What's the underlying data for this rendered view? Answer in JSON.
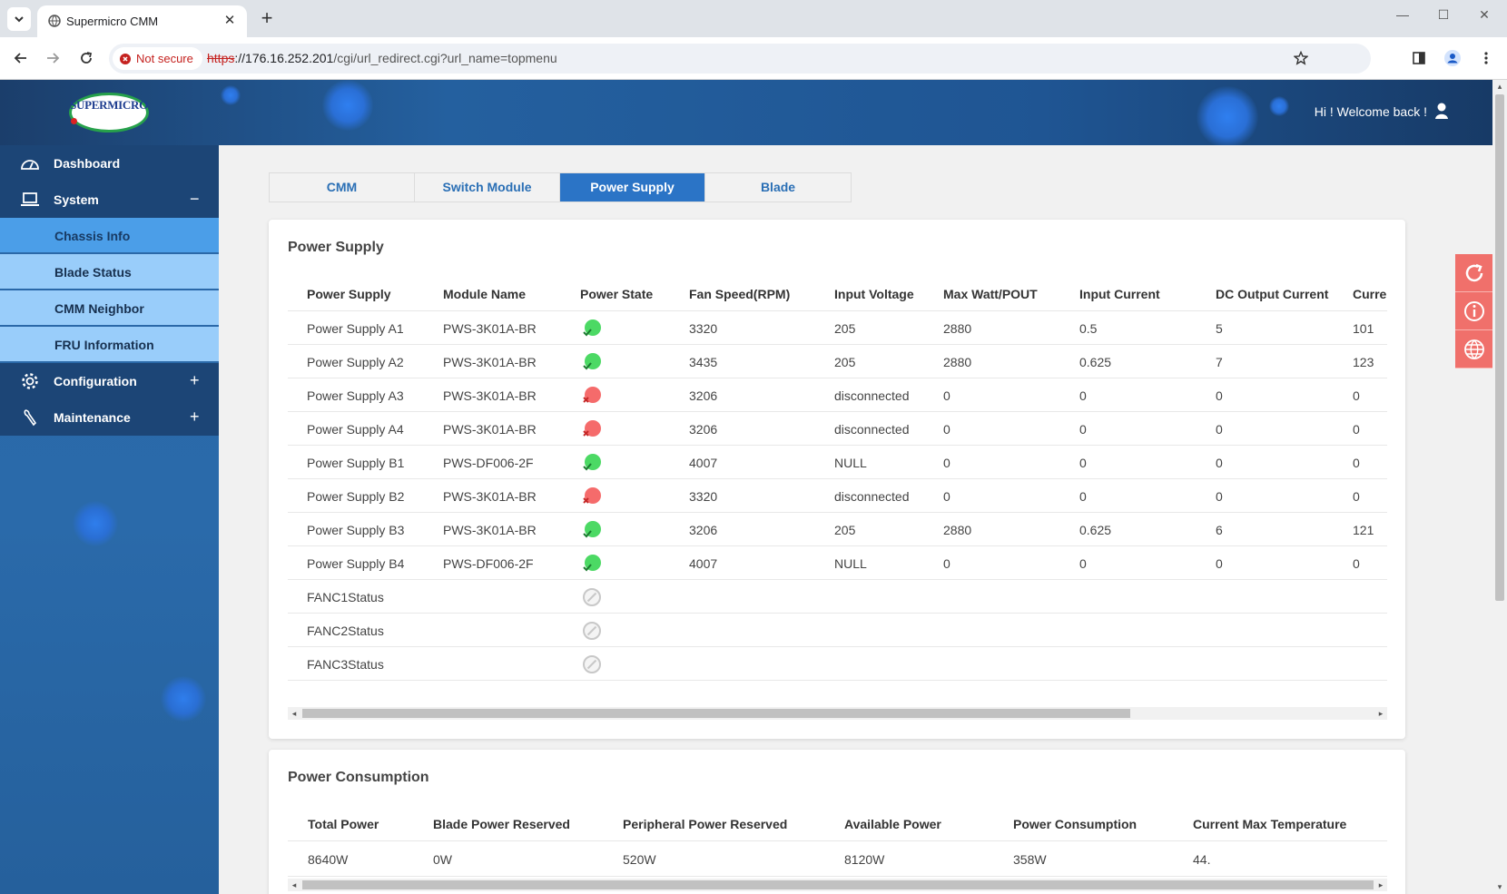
{
  "browser": {
    "tab_title": "Supermicro CMM",
    "tab_close": "✕",
    "new_tab": "+",
    "security_label": "Not secure",
    "url_scheme": "https",
    "url_host": "://176.16.252.201",
    "url_path": "/cgi/url_redirect.cgi?url_name=topmenu"
  },
  "header": {
    "logo_text": "SUPERMICRO",
    "welcome": "Hi ! Welcome back !"
  },
  "sidebar": {
    "dashboard": "Dashboard",
    "system": "System",
    "system_sign": "−",
    "system_items": [
      "Chassis Info",
      "Blade Status",
      "CMM Neighbor",
      "FRU Information"
    ],
    "active_item": "Chassis Info",
    "configuration": "Configuration",
    "configuration_sign": "+",
    "maintenance": "Maintenance",
    "maintenance_sign": "+"
  },
  "tabs": {
    "items": [
      "CMM",
      "Switch Module",
      "Power Supply",
      "Blade"
    ],
    "active": "Power Supply"
  },
  "power_supply": {
    "title": "Power Supply",
    "columns": [
      "Power Supply",
      "Module Name",
      "Power State",
      "Fan Speed(RPM)",
      "Input Voltage",
      "Max Watt/POUT",
      "Input Current",
      "DC Output Current",
      "Curre"
    ],
    "rows": [
      {
        "name": "Power Supply A1",
        "module": "PWS-3K01A-BR",
        "state": "ok",
        "fan": "3320",
        "voltage": "205",
        "maxwatt": "2880",
        "input_current": "0.5",
        "dc_current": "5",
        "curr": "101"
      },
      {
        "name": "Power Supply A2",
        "module": "PWS-3K01A-BR",
        "state": "ok",
        "fan": "3435",
        "voltage": "205",
        "maxwatt": "2880",
        "input_current": "0.625",
        "dc_current": "7",
        "curr": "123"
      },
      {
        "name": "Power Supply A3",
        "module": "PWS-3K01A-BR",
        "state": "fail",
        "fan": "3206",
        "voltage": "disconnected",
        "maxwatt": "0",
        "input_current": "0",
        "dc_current": "0",
        "curr": "0"
      },
      {
        "name": "Power Supply A4",
        "module": "PWS-3K01A-BR",
        "state": "fail",
        "fan": "3206",
        "voltage": "disconnected",
        "maxwatt": "0",
        "input_current": "0",
        "dc_current": "0",
        "curr": "0"
      },
      {
        "name": "Power Supply B1",
        "module": "PWS-DF006-2F",
        "state": "ok",
        "fan": "4007",
        "voltage": "NULL",
        "maxwatt": "0",
        "input_current": "0",
        "dc_current": "0",
        "curr": "0"
      },
      {
        "name": "Power Supply B2",
        "module": "PWS-3K01A-BR",
        "state": "fail",
        "fan": "3320",
        "voltage": "disconnected",
        "maxwatt": "0",
        "input_current": "0",
        "dc_current": "0",
        "curr": "0"
      },
      {
        "name": "Power Supply B3",
        "module": "PWS-3K01A-BR",
        "state": "ok",
        "fan": "3206",
        "voltage": "205",
        "maxwatt": "2880",
        "input_current": "0.625",
        "dc_current": "6",
        "curr": "121"
      },
      {
        "name": "Power Supply B4",
        "module": "PWS-DF006-2F",
        "state": "ok",
        "fan": "4007",
        "voltage": "NULL",
        "maxwatt": "0",
        "input_current": "0",
        "dc_current": "0",
        "curr": "0"
      },
      {
        "name": "FANC1Status",
        "module": "",
        "state": "na",
        "fan": "",
        "voltage": "",
        "maxwatt": "",
        "input_current": "",
        "dc_current": "",
        "curr": ""
      },
      {
        "name": "FANC2Status",
        "module": "",
        "state": "na",
        "fan": "",
        "voltage": "",
        "maxwatt": "",
        "input_current": "",
        "dc_current": "",
        "curr": ""
      },
      {
        "name": "FANC3Status",
        "module": "",
        "state": "na",
        "fan": "",
        "voltage": "",
        "maxwatt": "",
        "input_current": "",
        "dc_current": "",
        "curr": ""
      }
    ]
  },
  "power_consumption": {
    "title": "Power Consumption",
    "columns": [
      "Total Power",
      "Blade Power Reserved",
      "Peripheral Power Reserved",
      "Available Power",
      "Power Consumption",
      "Current Max Temperature"
    ],
    "values": [
      "8640W",
      "0W",
      "520W",
      "8120W",
      "358W",
      "44."
    ]
  },
  "colors": {
    "ok": "#4cd964",
    "fail": "#f56b6b",
    "accent": "#2b74c6",
    "float_btn": "#f0706b"
  },
  "icons": [
    "dashboard-icon",
    "laptop-icon",
    "gear-icon",
    "wrench-icon",
    "refresh-icon",
    "info-icon",
    "globe-icon",
    "user-icon",
    "star-icon",
    "profile-icon",
    "menu-icon"
  ]
}
